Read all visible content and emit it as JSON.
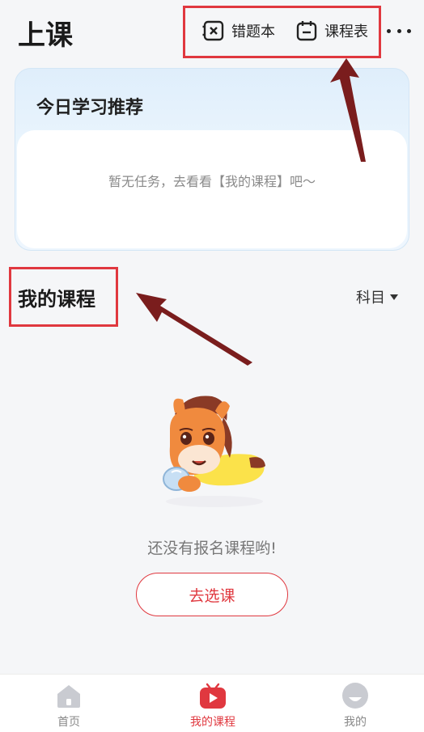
{
  "header": {
    "title": "上课",
    "wrong_book_label": "错题本",
    "wrong_book_icon": "wrong-book-icon",
    "schedule_label": "课程表",
    "schedule_icon": "calendar-icon",
    "more_icon": "more-dots-icon"
  },
  "recommendation": {
    "title": "今日学习推荐",
    "empty_message": "暂无任务，去看看【我的课程】吧～"
  },
  "my_courses": {
    "title": "我的课程",
    "filter_label": "科目",
    "empty_message": "还没有报名课程哟!",
    "choose_button": "去选课"
  },
  "tabs": [
    {
      "label": "首页",
      "icon": "home-icon",
      "active": false
    },
    {
      "label": "我的课程",
      "icon": "play-icon",
      "active": true
    },
    {
      "label": "我的",
      "icon": "profile-icon",
      "active": false
    }
  ],
  "colors": {
    "accent": "#e0383f",
    "annotation": "#e0383f",
    "arrow": "#7a1d1d"
  }
}
